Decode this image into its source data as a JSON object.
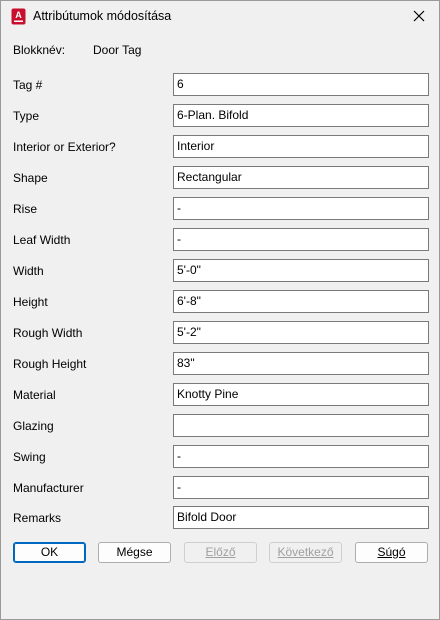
{
  "window": {
    "title": "Attribútumok módosítása",
    "app_icon": "autocad-icon",
    "close_icon": "close-icon"
  },
  "block": {
    "label": "Blokknév:",
    "value": "Door Tag"
  },
  "attributes": [
    {
      "label": "Tag #",
      "value": "6"
    },
    {
      "label": "Type",
      "value": "6-Plan. Bifold"
    },
    {
      "label": "Interior or Exterior?",
      "value": "Interior"
    },
    {
      "label": "Shape",
      "value": "Rectangular"
    },
    {
      "label": "Rise",
      "value": "-"
    },
    {
      "label": "Leaf Width",
      "value": "-"
    },
    {
      "label": "Width",
      "value": "5'-0\""
    },
    {
      "label": "Height",
      "value": "6'-8\""
    },
    {
      "label": "Rough Width",
      "value": "5'-2\""
    },
    {
      "label": "Rough Height",
      "value": "83\""
    },
    {
      "label": "Material",
      "value": "Knotty Pine"
    },
    {
      "label": "Glazing",
      "value": ""
    },
    {
      "label": "Swing",
      "value": "-"
    },
    {
      "label": "Manufacturer",
      "value": "-"
    },
    {
      "label": "Remarks",
      "value": "Bifold Door"
    }
  ],
  "buttons": {
    "ok": "OK",
    "cancel": "Mégse",
    "previous": "Előző",
    "next": "Következő",
    "help": "Súgó"
  },
  "colors": {
    "accent": "#0067c0",
    "app_icon_red": "#c8102e"
  }
}
